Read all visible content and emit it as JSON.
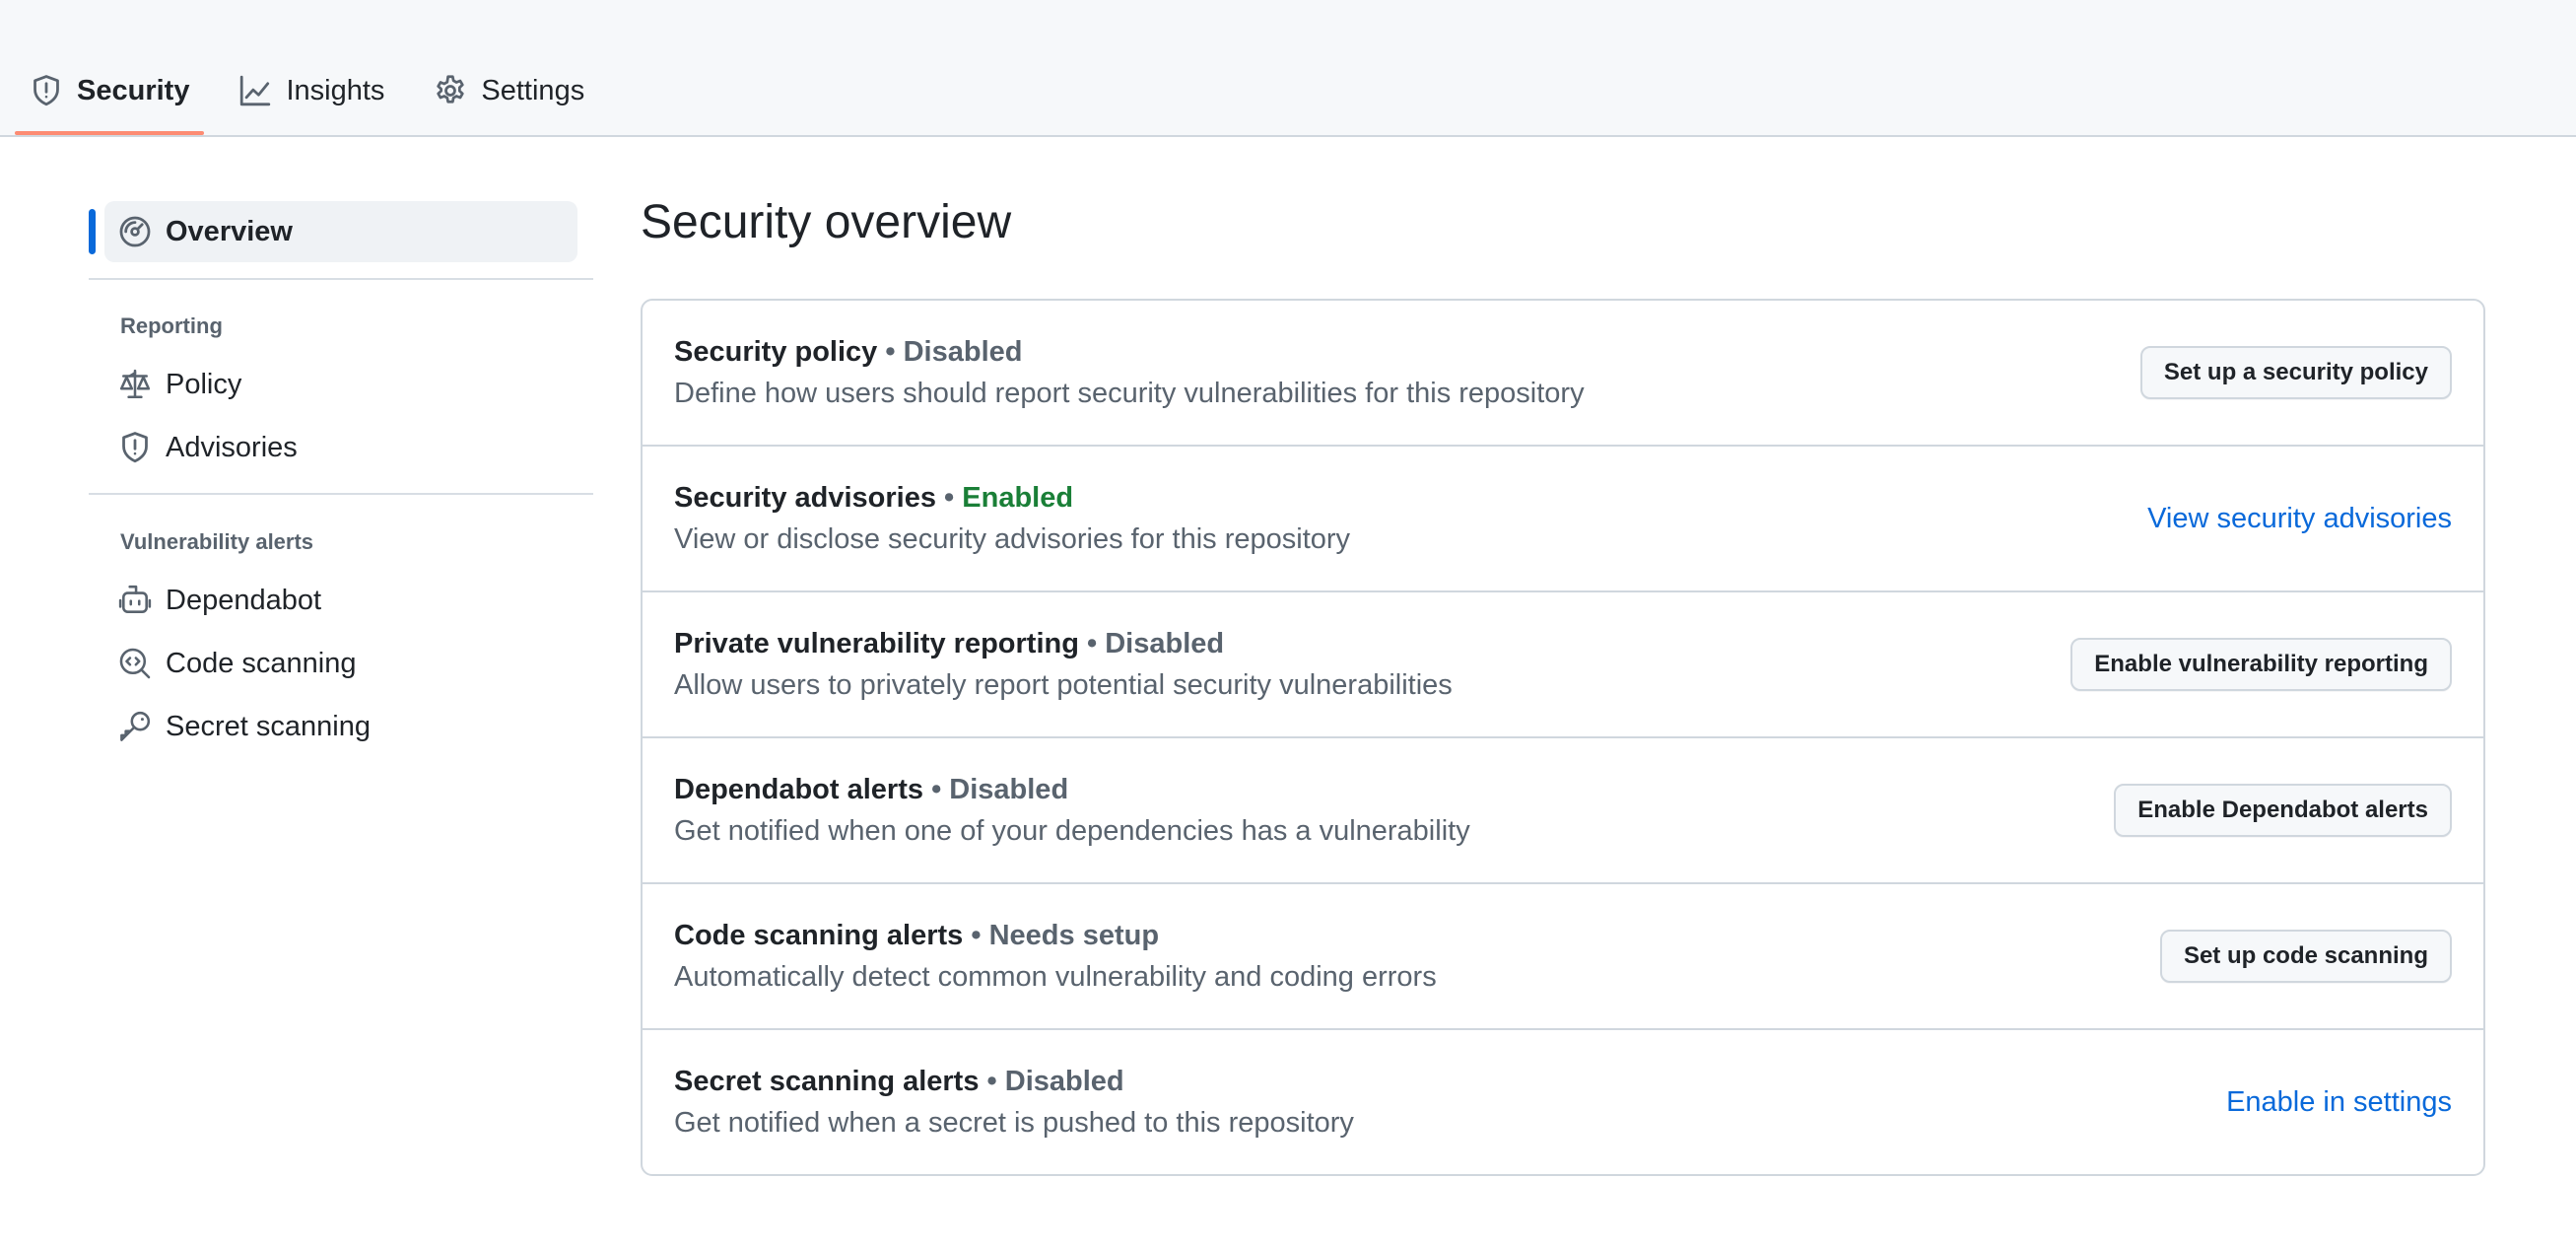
{
  "tabs": [
    {
      "label": "Security",
      "icon": "shield-icon",
      "active": true
    },
    {
      "label": "Insights",
      "icon": "graph-icon",
      "active": false
    },
    {
      "label": "Settings",
      "icon": "gear-icon",
      "active": false
    }
  ],
  "sidebar": {
    "overview": {
      "label": "Overview",
      "icon": "meter-icon"
    },
    "reporting": {
      "heading": "Reporting",
      "items": [
        {
          "label": "Policy",
          "icon": "law-icon"
        },
        {
          "label": "Advisories",
          "icon": "shield-icon"
        }
      ]
    },
    "vulnerability_alerts": {
      "heading": "Vulnerability alerts",
      "items": [
        {
          "label": "Dependabot",
          "icon": "dependabot-icon"
        },
        {
          "label": "Code scanning",
          "icon": "codescan-icon"
        },
        {
          "label": "Secret scanning",
          "icon": "key-icon"
        }
      ]
    }
  },
  "main": {
    "title": "Security overview",
    "separator": "•",
    "rows": [
      {
        "title": "Security policy",
        "status": "Disabled",
        "description": "Define how users should report security vulnerabilities for this repository",
        "action": "Set up a security policy",
        "action_type": "button"
      },
      {
        "title": "Security advisories",
        "status": "Enabled",
        "description": "View or disclose security advisories for this repository",
        "action": "View security advisories",
        "action_type": "link"
      },
      {
        "title": "Private vulnerability reporting",
        "status": "Disabled",
        "description": "Allow users to privately report potential security vulnerabilities",
        "action": "Enable vulnerability reporting",
        "action_type": "button"
      },
      {
        "title": "Dependabot alerts",
        "status": "Disabled",
        "description": "Get notified when one of your dependencies has a vulnerability",
        "action": "Enable Dependabot alerts",
        "action_type": "button"
      },
      {
        "title": "Code scanning alerts",
        "status": "Needs setup",
        "description": "Automatically detect common vulnerability and coding errors",
        "action": "Set up code scanning",
        "action_type": "button"
      },
      {
        "title": "Secret scanning alerts",
        "status": "Disabled",
        "description": "Get notified when a secret is pushed to this repository",
        "action": "Enable in settings",
        "action_type": "link"
      }
    ]
  },
  "colors": {
    "accent_blue": "#0969da",
    "enabled_green": "#1a7f37",
    "muted_gray": "#59636e",
    "active_tab_underline": "#fd8c73"
  }
}
